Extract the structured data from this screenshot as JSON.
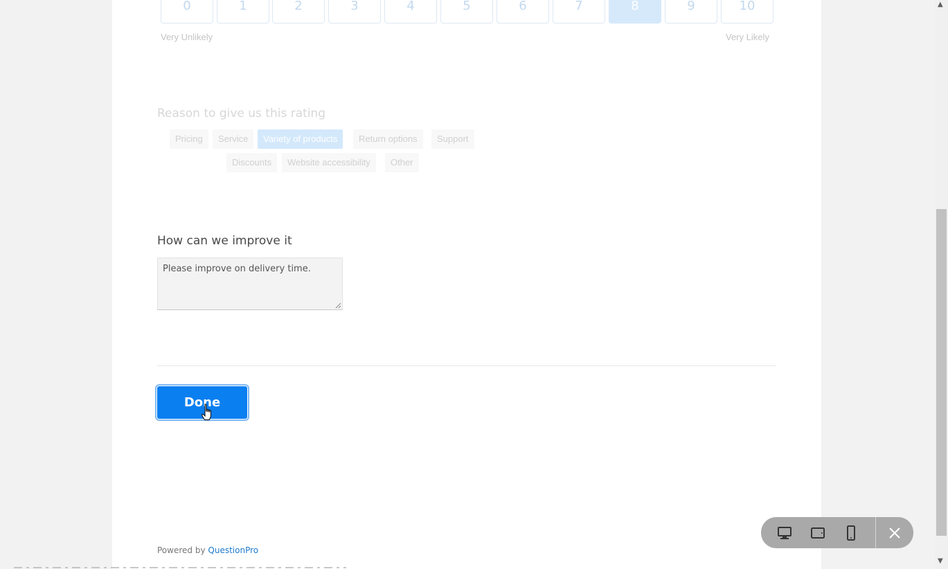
{
  "nps": {
    "options": [
      "0",
      "1",
      "2",
      "3",
      "4",
      "5",
      "6",
      "7",
      "8",
      "9",
      "10"
    ],
    "selected": "8",
    "low_label": "Very Unlikely",
    "high_label": "Very Likely"
  },
  "reason": {
    "title": "Reason to give us this rating",
    "chips": [
      "Pricing",
      "Service",
      "Variety of products",
      "Return options",
      "Support",
      "Discounts",
      "Website accessibility",
      "Other"
    ],
    "selected": "Variety of products"
  },
  "improve": {
    "title": "How can we improve it",
    "value": "Please improve on delivery time."
  },
  "done_label": "Done",
  "footer": {
    "powered_by": "Powered by",
    "brand": "QuestionPro"
  },
  "colors": {
    "accent": "#0a7ff0",
    "brand_link": "#1e7acc",
    "selected_light": "#d6e9fb"
  },
  "device_toolbar": {
    "icons": [
      "desktop-icon",
      "tablet-landscape-icon",
      "mobile-icon",
      "close-icon"
    ]
  }
}
